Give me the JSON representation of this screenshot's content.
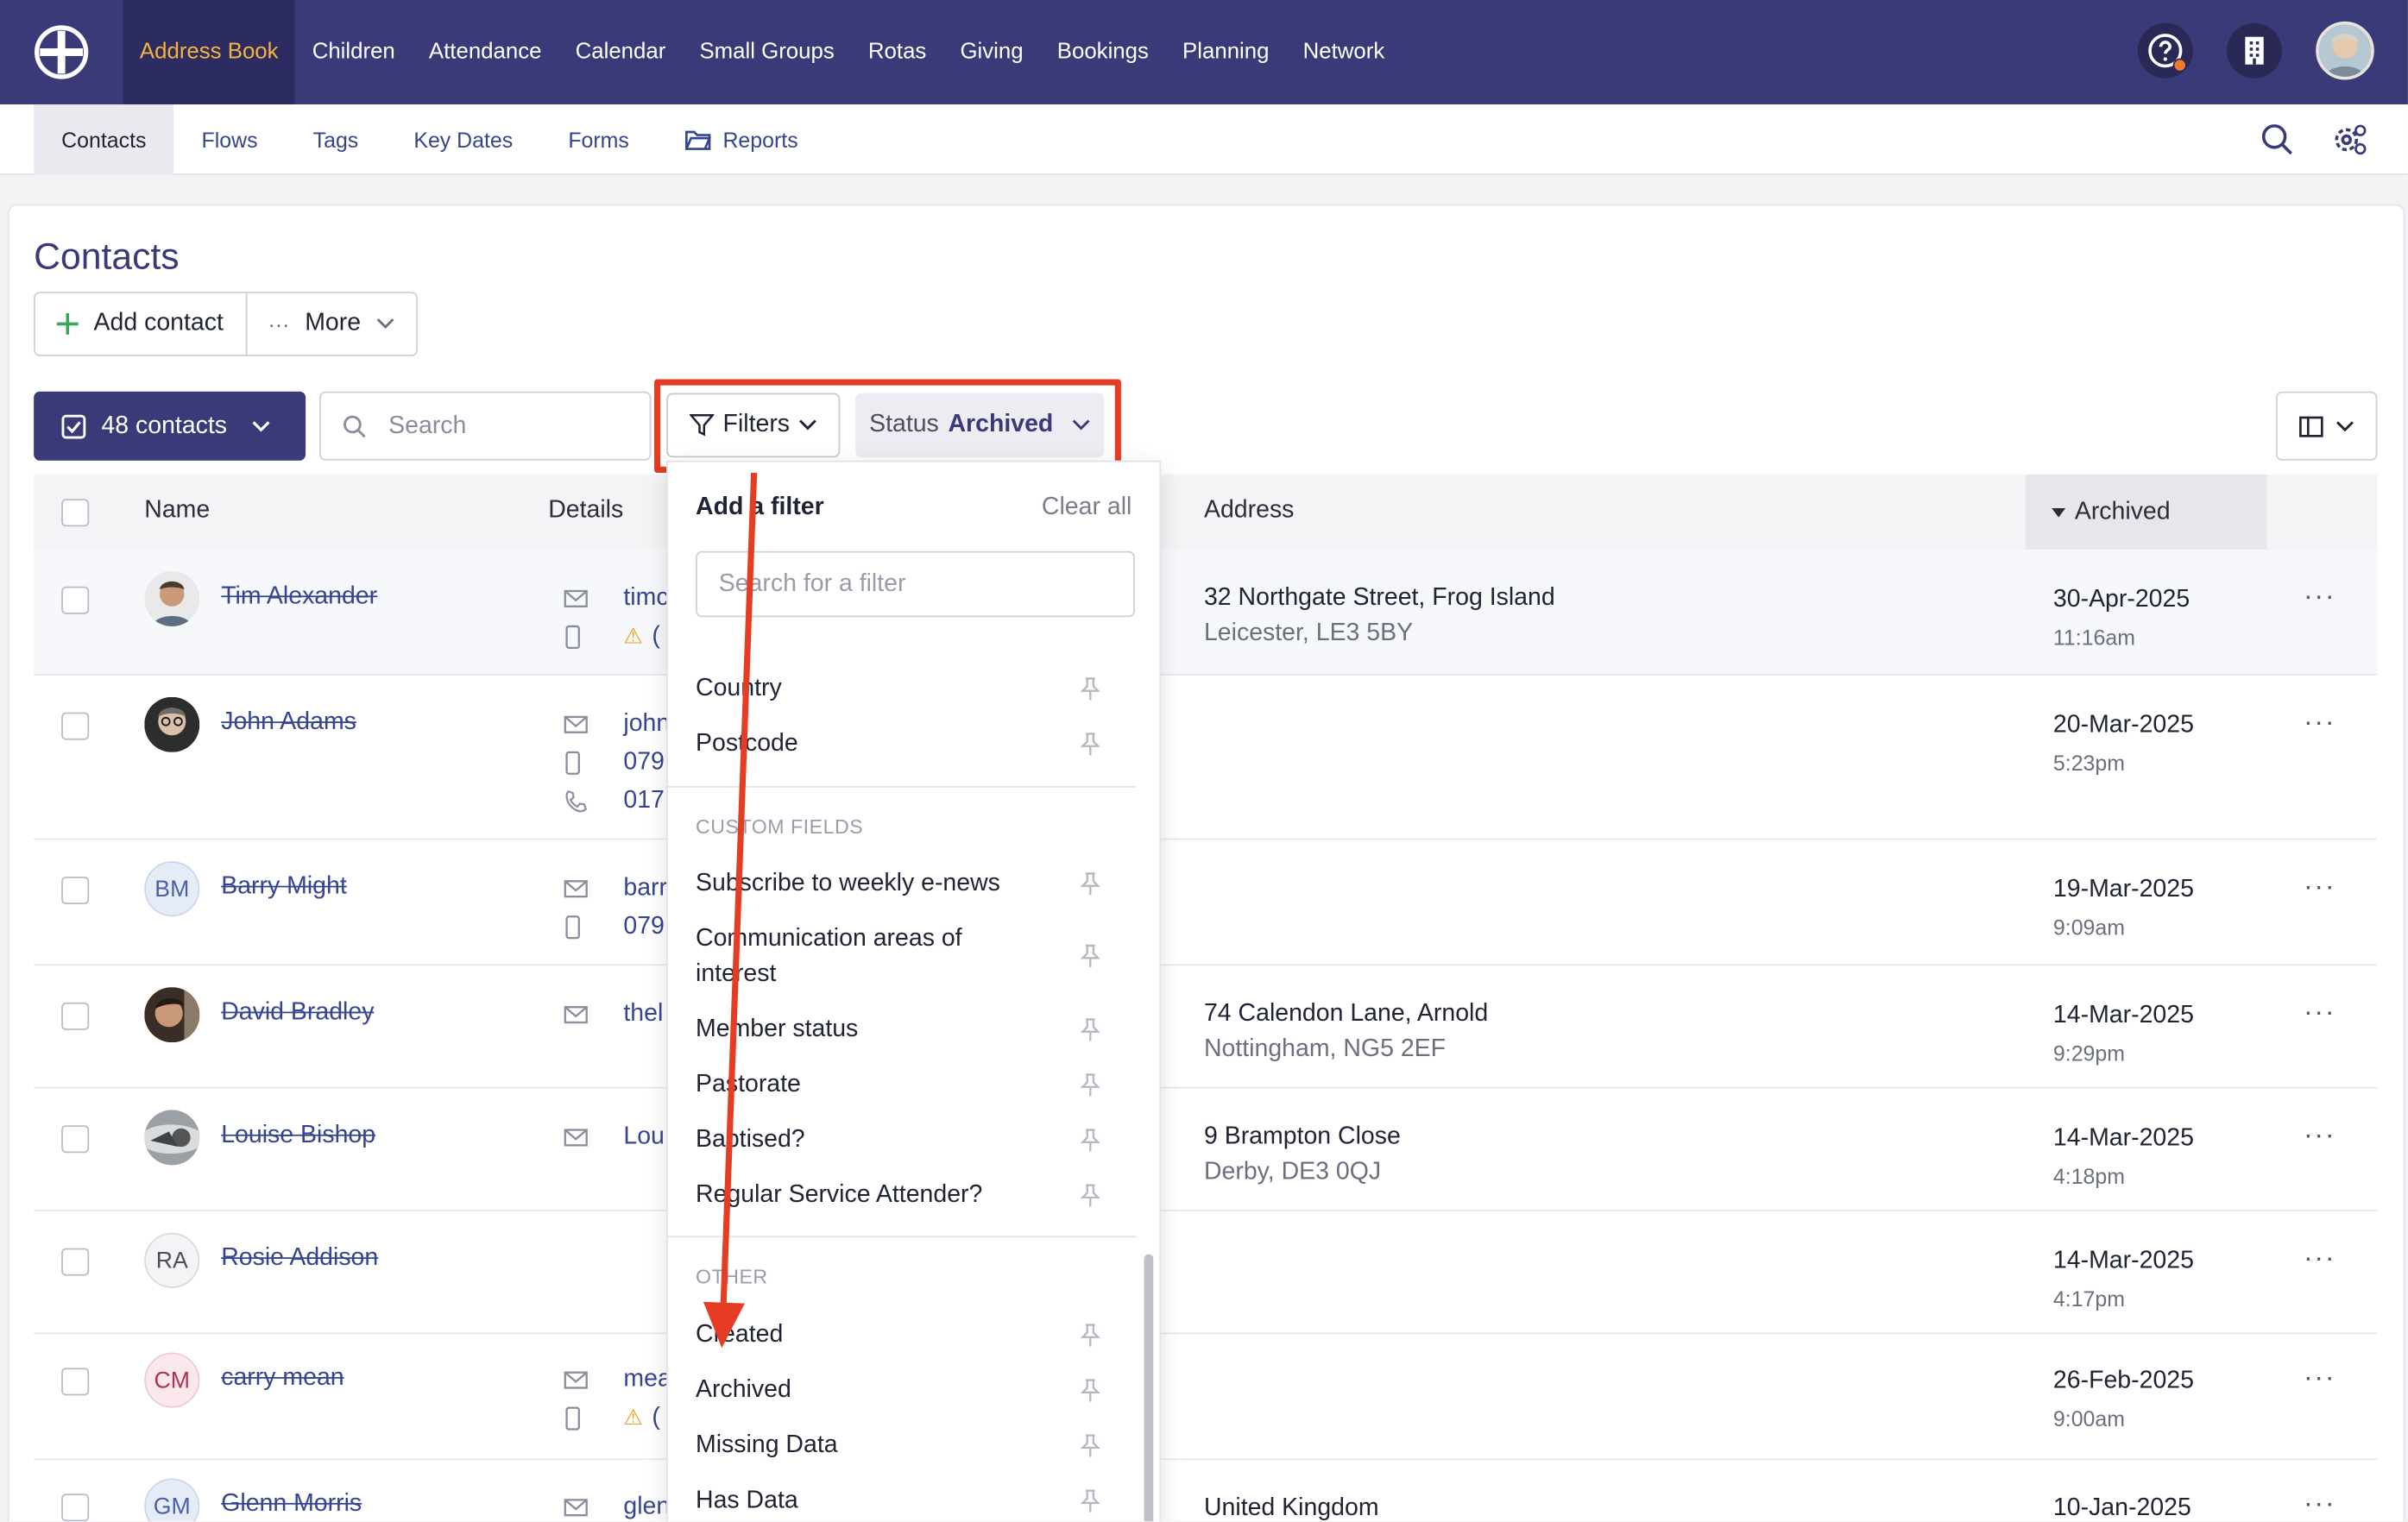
{
  "topnav": {
    "items": [
      "Address Book",
      "Children",
      "Attendance",
      "Calendar",
      "Small Groups",
      "Rotas",
      "Giving",
      "Bookings",
      "Planning",
      "Network"
    ],
    "active": "Address Book"
  },
  "subnav": {
    "items": [
      "Contacts",
      "Flows",
      "Tags",
      "Key Dates",
      "Forms",
      "Reports"
    ],
    "active": "Contacts"
  },
  "page": {
    "title": "Contacts",
    "add_contact": "Add contact",
    "more": "More",
    "contacts_count": "48 contacts",
    "search_placeholder": "Search",
    "filters": "Filters",
    "status_label": "Status",
    "status_value": "Archived"
  },
  "table": {
    "headers": {
      "name": "Name",
      "details": "Details",
      "address": "Address",
      "archived": "Archived"
    },
    "rows": [
      {
        "initials": "",
        "name": "Tim Alexander",
        "details": [
          "timс",
          "("
        ],
        "address1": "32 Northgate Street, Frog Island",
        "address2": "Leicester, LE3 5BY",
        "date": "30-Apr-2025",
        "time": "11:16am"
      },
      {
        "initials": "",
        "name": "John Adams",
        "details": [
          "john",
          "079",
          "017"
        ],
        "address1": "",
        "address2": "",
        "date": "20-Mar-2025",
        "time": "5:23pm"
      },
      {
        "initials": "BM",
        "name": "Barry Might",
        "details": [
          "barr",
          "079"
        ],
        "address1": "",
        "address2": "",
        "date": "19-Mar-2025",
        "time": "9:09am"
      },
      {
        "initials": "",
        "name": "David Bradley",
        "details": [
          "thel"
        ],
        "address1": "74 Calendon Lane, Arnold",
        "address2": "Nottingham, NG5 2EF",
        "date": "14-Mar-2025",
        "time": "9:29pm"
      },
      {
        "initials": "",
        "name": "Louise Bishop",
        "details": [
          "Lou"
        ],
        "address1": "9 Brampton Close",
        "address2": "Derby, DE3 0QJ",
        "date": "14-Mar-2025",
        "time": "4:18pm"
      },
      {
        "initials": "RA",
        "name": "Rosie Addison",
        "details": [],
        "address1": "",
        "address2": "",
        "date": "14-Mar-2025",
        "time": "4:17pm"
      },
      {
        "initials": "CM",
        "name": "carry mean",
        "details": [
          "mea",
          "("
        ],
        "address1": "",
        "address2": "",
        "date": "26-Feb-2025",
        "time": "9:00am"
      },
      {
        "initials": "GM",
        "name": "Glenn Morris",
        "details": [
          "glen"
        ],
        "address1": "United Kingdom",
        "address2": "",
        "date": "10-Jan-2025",
        "time": ""
      }
    ]
  },
  "filter_dropdown": {
    "heading": "Add a filter",
    "clear_all": "Clear all",
    "search_placeholder": "Search for a filter",
    "options_top": [
      "Country",
      "Postcode"
    ],
    "custom_fields_heading": "CUSTOM FIELDS",
    "custom_fields": [
      "Subscribe to weekly e-news",
      "Communication areas of interest",
      "Member status",
      "Pastorate",
      "Baptised?",
      "Regular Service Attender?"
    ],
    "other_heading": "OTHER",
    "other": [
      "Created",
      "Archived",
      "Missing Data",
      "Has Data"
    ]
  },
  "colors": {
    "nav": "#3b3a78",
    "accent": "#f2b43e",
    "link": "#36458f",
    "highlight": "#e63c24"
  }
}
